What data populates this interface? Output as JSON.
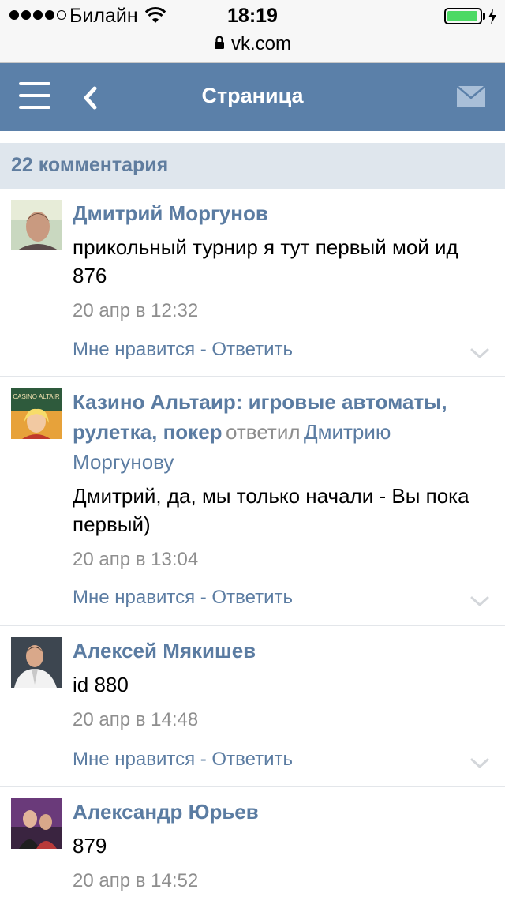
{
  "status_bar": {
    "carrier": "Билайн",
    "time": "18:19",
    "battery_level": 0.95,
    "battery_color": "#4cd964"
  },
  "url_bar": {
    "url": "vk.com",
    "icon": "lock-icon"
  },
  "header": {
    "title": "Страница",
    "menu_icon": "menu-icon",
    "back_icon": "chevron-left-icon",
    "mail_icon": "mail-icon",
    "background": "#5b80a9"
  },
  "comments_count": "22 комментария",
  "comments": [
    {
      "author": "Дмитрий Моргунов",
      "text": "прикольный турнир я тут первый мой ид 876",
      "date": "20 апр в 12:32",
      "like_label": "Мне нравится",
      "reply_label": "Ответить"
    },
    {
      "author": "Казино Альтаир: игровые автоматы, рулетка, покер",
      "reply_verb": "ответил",
      "reply_to": "Дмитрию Моргунову",
      "avatar_text": "CASINO ALTAIR",
      "text": "Дмитрий, да, мы только начали - Вы пока первый)",
      "date": "20 апр в 13:04",
      "like_label": "Мне нравится",
      "reply_label": "Ответить"
    },
    {
      "author": "Алексей Мякишев",
      "text": "id 880",
      "date": "20 апр в 14:48",
      "like_label": "Мне нравится",
      "reply_label": "Ответить"
    },
    {
      "author": "Александр Юрьев",
      "text": "879",
      "date": "20 апр в 14:52"
    }
  ],
  "separator": " - ",
  "colors": {
    "link": "#5b7ca2",
    "count_bar_bg": "#dfe6ed",
    "muted": "#8e8e8e"
  }
}
